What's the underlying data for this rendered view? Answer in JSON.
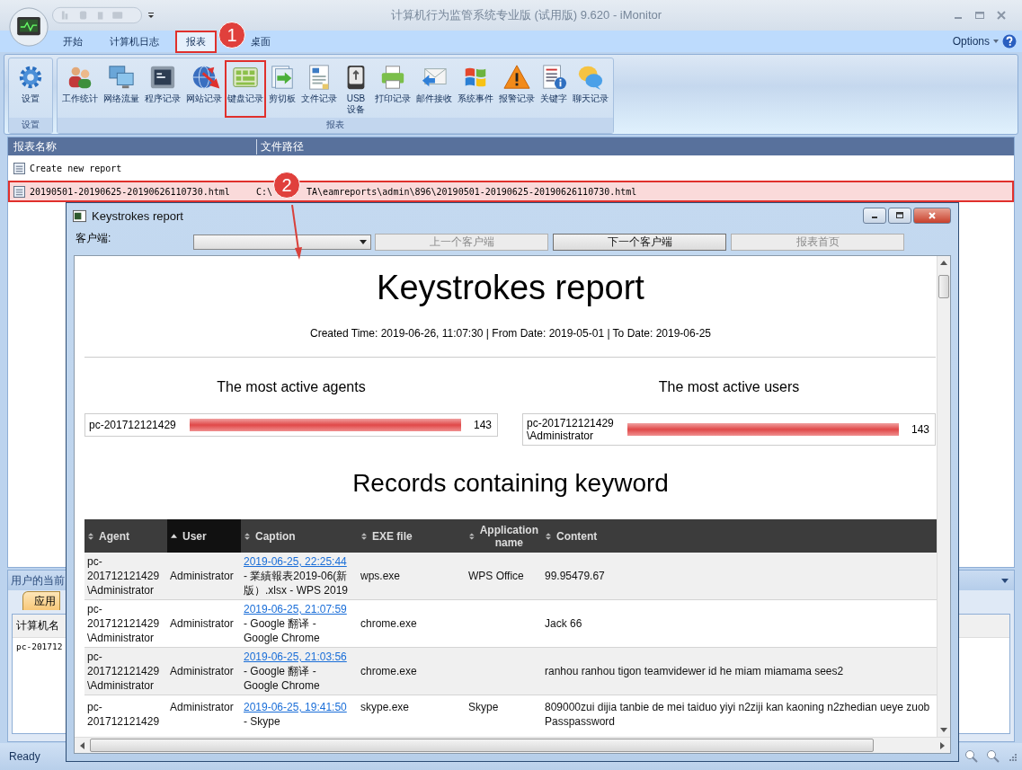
{
  "window": {
    "title": "计算机行为监管系统专业版 (试用版) 9.620 - iMonitor"
  },
  "ribbon_tabs": [
    {
      "label": "开始",
      "selected": false,
      "annotated": false
    },
    {
      "label": "计算机日志",
      "selected": false,
      "annotated": false
    },
    {
      "label": "报表",
      "selected": true,
      "annotated": true
    },
    {
      "label": "桌面",
      "selected": false,
      "annotated": false
    }
  ],
  "options": "Options",
  "ribbon_groups": [
    {
      "label": "设置",
      "buttons": [
        {
          "label": "设置",
          "annotated": false
        }
      ]
    },
    {
      "label": "报表",
      "buttons": [
        {
          "label": "工作统计",
          "annotated": false
        },
        {
          "label": "网络流量",
          "annotated": false
        },
        {
          "label": "程序记录",
          "annotated": false
        },
        {
          "label": "网站记录",
          "annotated": false
        },
        {
          "label": "键盘记录",
          "annotated": true
        },
        {
          "label": "剪切板",
          "annotated": false
        },
        {
          "label": "文件记录",
          "annotated": false
        },
        {
          "label": "USB\n设备",
          "annotated": false
        },
        {
          "label": "打印记录",
          "annotated": false
        },
        {
          "label": "邮件接收",
          "annotated": false
        },
        {
          "label": "系统事件",
          "annotated": false
        },
        {
          "label": "报警记录",
          "annotated": false
        },
        {
          "label": "关键字",
          "annotated": false
        },
        {
          "label": "聊天记录",
          "annotated": false
        }
      ]
    }
  ],
  "annotations": [
    {
      "label": "1"
    },
    {
      "label": "2"
    }
  ],
  "report_list": {
    "columns": [
      "报表名称",
      "文件路径"
    ],
    "rows": [
      {
        "name": "Create new report",
        "selected": false
      },
      {
        "name": "20190501-20190625-20190626110730.html",
        "path_start": "C:\\",
        "path_end": "TA\\eamreports\\admin\\896\\20190501-20190625-20190626110730.html",
        "selected": true
      }
    ]
  },
  "lower_panel": {
    "title": "用户的当前",
    "tab": "应用",
    "column": "计算机名",
    "cell": "pc-201712"
  },
  "status_bar": {
    "text": "Ready"
  },
  "dialog": {
    "title": "Keystrokes report",
    "client_label": "客户端:",
    "buttons": [
      {
        "label": "上一个客户端",
        "disabled": true
      },
      {
        "label": "下一个客户端",
        "disabled": false
      },
      {
        "label": "报表首页",
        "disabled": true
      }
    ],
    "report": {
      "title": "Keystrokes report",
      "meta": "Created Time: 2019-06-26, 11:07:30 | From Date: 2019-05-01 | To Date: 2019-06-25",
      "tops": [
        {
          "title": "The most active agents",
          "name": "pc-201712121429",
          "level": 1,
          "count": "143"
        },
        {
          "title": "The most active users",
          "name": "pc-201712121429\n\\Administrator",
          "level": 1,
          "count": "143"
        }
      ],
      "records_title": "Records containing keyword",
      "columns": [
        {
          "label": "Agent",
          "sorted": false
        },
        {
          "label": "User",
          "sorted": true
        },
        {
          "label": "Caption",
          "sorted": false
        },
        {
          "label": "EXE file",
          "sorted": false
        },
        {
          "label": "Application\nname",
          "sorted": false
        },
        {
          "label": "Content",
          "sorted": false
        }
      ],
      "rows": [
        {
          "agent": "pc-\n201712121429\n\\Administrator",
          "user": "Administrator",
          "time": "2019-06-25, 22:25:44",
          "caption": "- 業績報表2019-06(新版）.xlsx - WPS 2019",
          "exe": "wps.exe",
          "app": "WPS Office",
          "content": "99.95479.67"
        },
        {
          "agent": "pc-\n201712121429\n\\Administrator",
          "user": "Administrator",
          "time": "2019-06-25, 21:07:59",
          "caption": "- Google 翻译  -\nGoogle Chrome",
          "exe": "chrome.exe",
          "content": "Jack 66"
        },
        {
          "agent": "pc-\n201712121429\n\\Administrator",
          "user": "Administrator",
          "time": "2019-06-25, 21:03:56",
          "caption": "- Google 翻译  -\nGoogle Chrome",
          "exe": "chrome.exe",
          "content": "ranhou ranhou tigon teamvidewer id he miam miamama sees2"
        },
        {
          "agent": "pc-\n201712121429",
          "user": "Administrator",
          "time": "2019-06-25, 19:41:50",
          "caption": "- Skype",
          "exe": "skype.exe",
          "app": "Skype",
          "content": "809000zui dijia tanbie de mei taiduo yiyi n2ziji kan kaoning n2zhedian ueye zuob\nPasspassword"
        }
      ]
    }
  }
}
